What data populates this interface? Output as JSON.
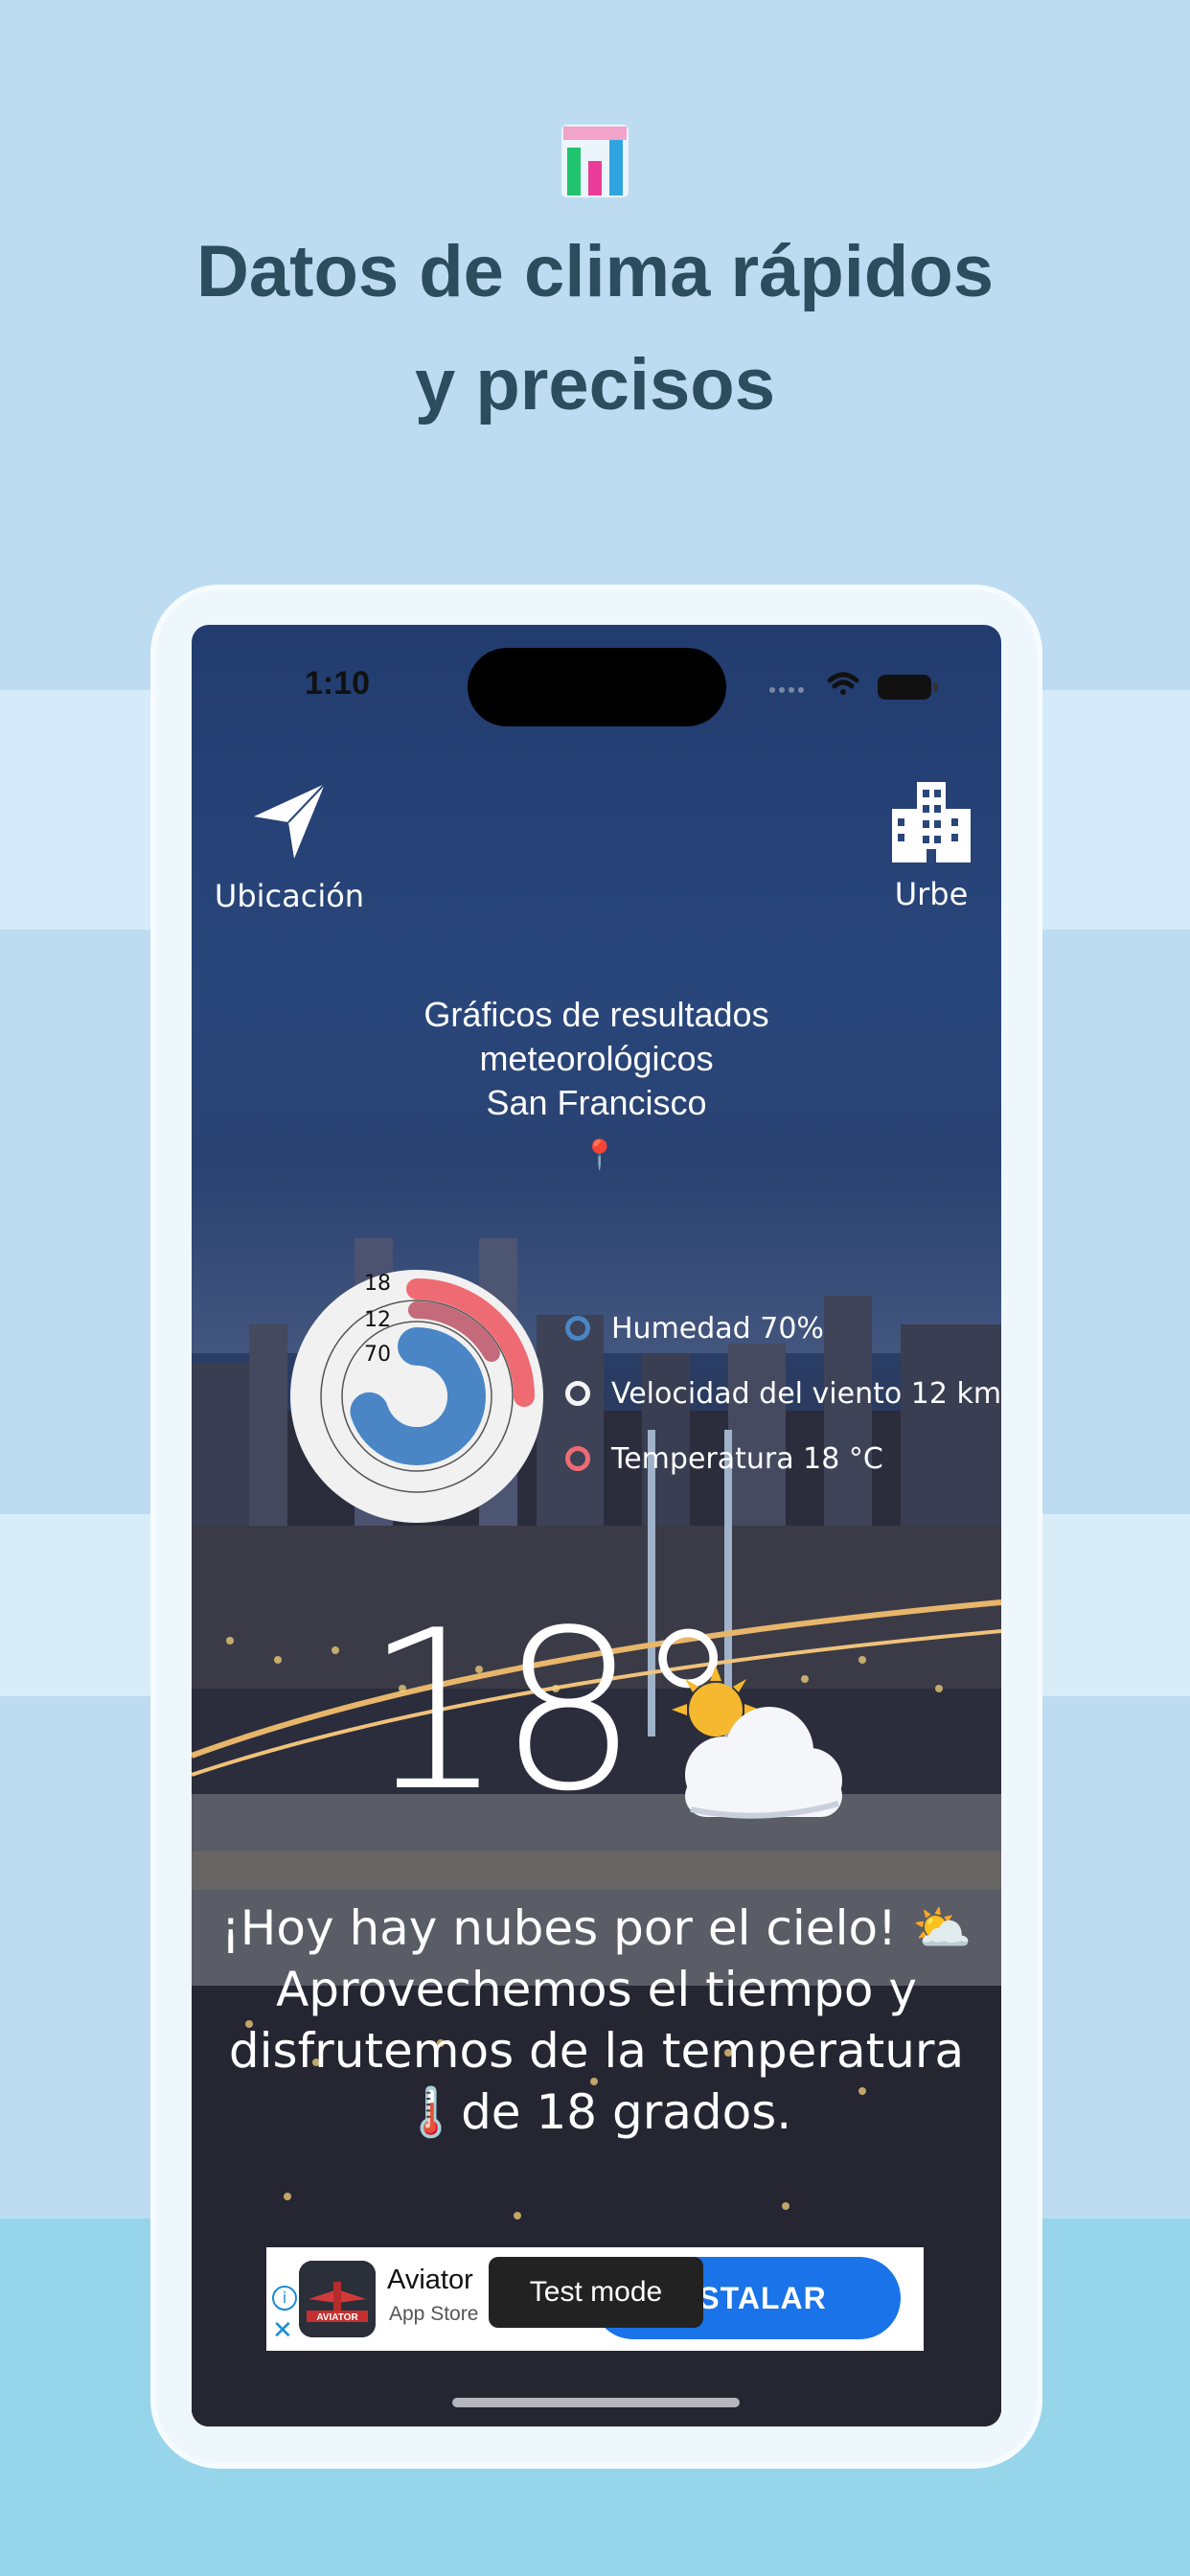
{
  "promo": {
    "headline_line1": "Datos de clima rápidos",
    "headline_line2": "y precisos",
    "icon": "bar-chart-icon"
  },
  "status_bar": {
    "time": "1:10"
  },
  "nav": {
    "location_label": "Ubicación",
    "location_icon": "navigation-arrow-icon",
    "city_label": "Urbe",
    "city_icon": "city-building-icon"
  },
  "chart_header": {
    "line1": "Gráficos de resultados",
    "line2": "meteorológicos",
    "city": "San Francisco",
    "pin_icon": "map-pin-icon"
  },
  "chart_data": {
    "type": "radial-bar",
    "rings": [
      {
        "label": "18",
        "value": 18,
        "color": "#ef6b73"
      },
      {
        "label": "12",
        "value": 12,
        "color": "#c46a7a"
      },
      {
        "label": "70",
        "value": 70,
        "color": "#4a86c5"
      }
    ],
    "legend": [
      {
        "text": "Humedad 70%",
        "color": "#4a86c5"
      },
      {
        "text": "Velocidad del viento 12 km",
        "color": "#f4f4f4"
      },
      {
        "text": "Temperatura 18 °C",
        "color": "#ef6b73"
      }
    ]
  },
  "current": {
    "temperature": "18°",
    "condition_icon": "sun-behind-cloud-icon"
  },
  "message": {
    "line1": "¡Hoy hay nubes por el cielo! ⛅",
    "line2": "Aprovechemos el tiempo y",
    "line3": "disfrutemos de la temperatura",
    "line4": "🌡️de 18 grados."
  },
  "ad": {
    "app_name": "Aviator",
    "store": "App Store",
    "install_label": "INSTALAR",
    "test_mode_label": "Test mode",
    "logo_text": "AVIATOR"
  }
}
